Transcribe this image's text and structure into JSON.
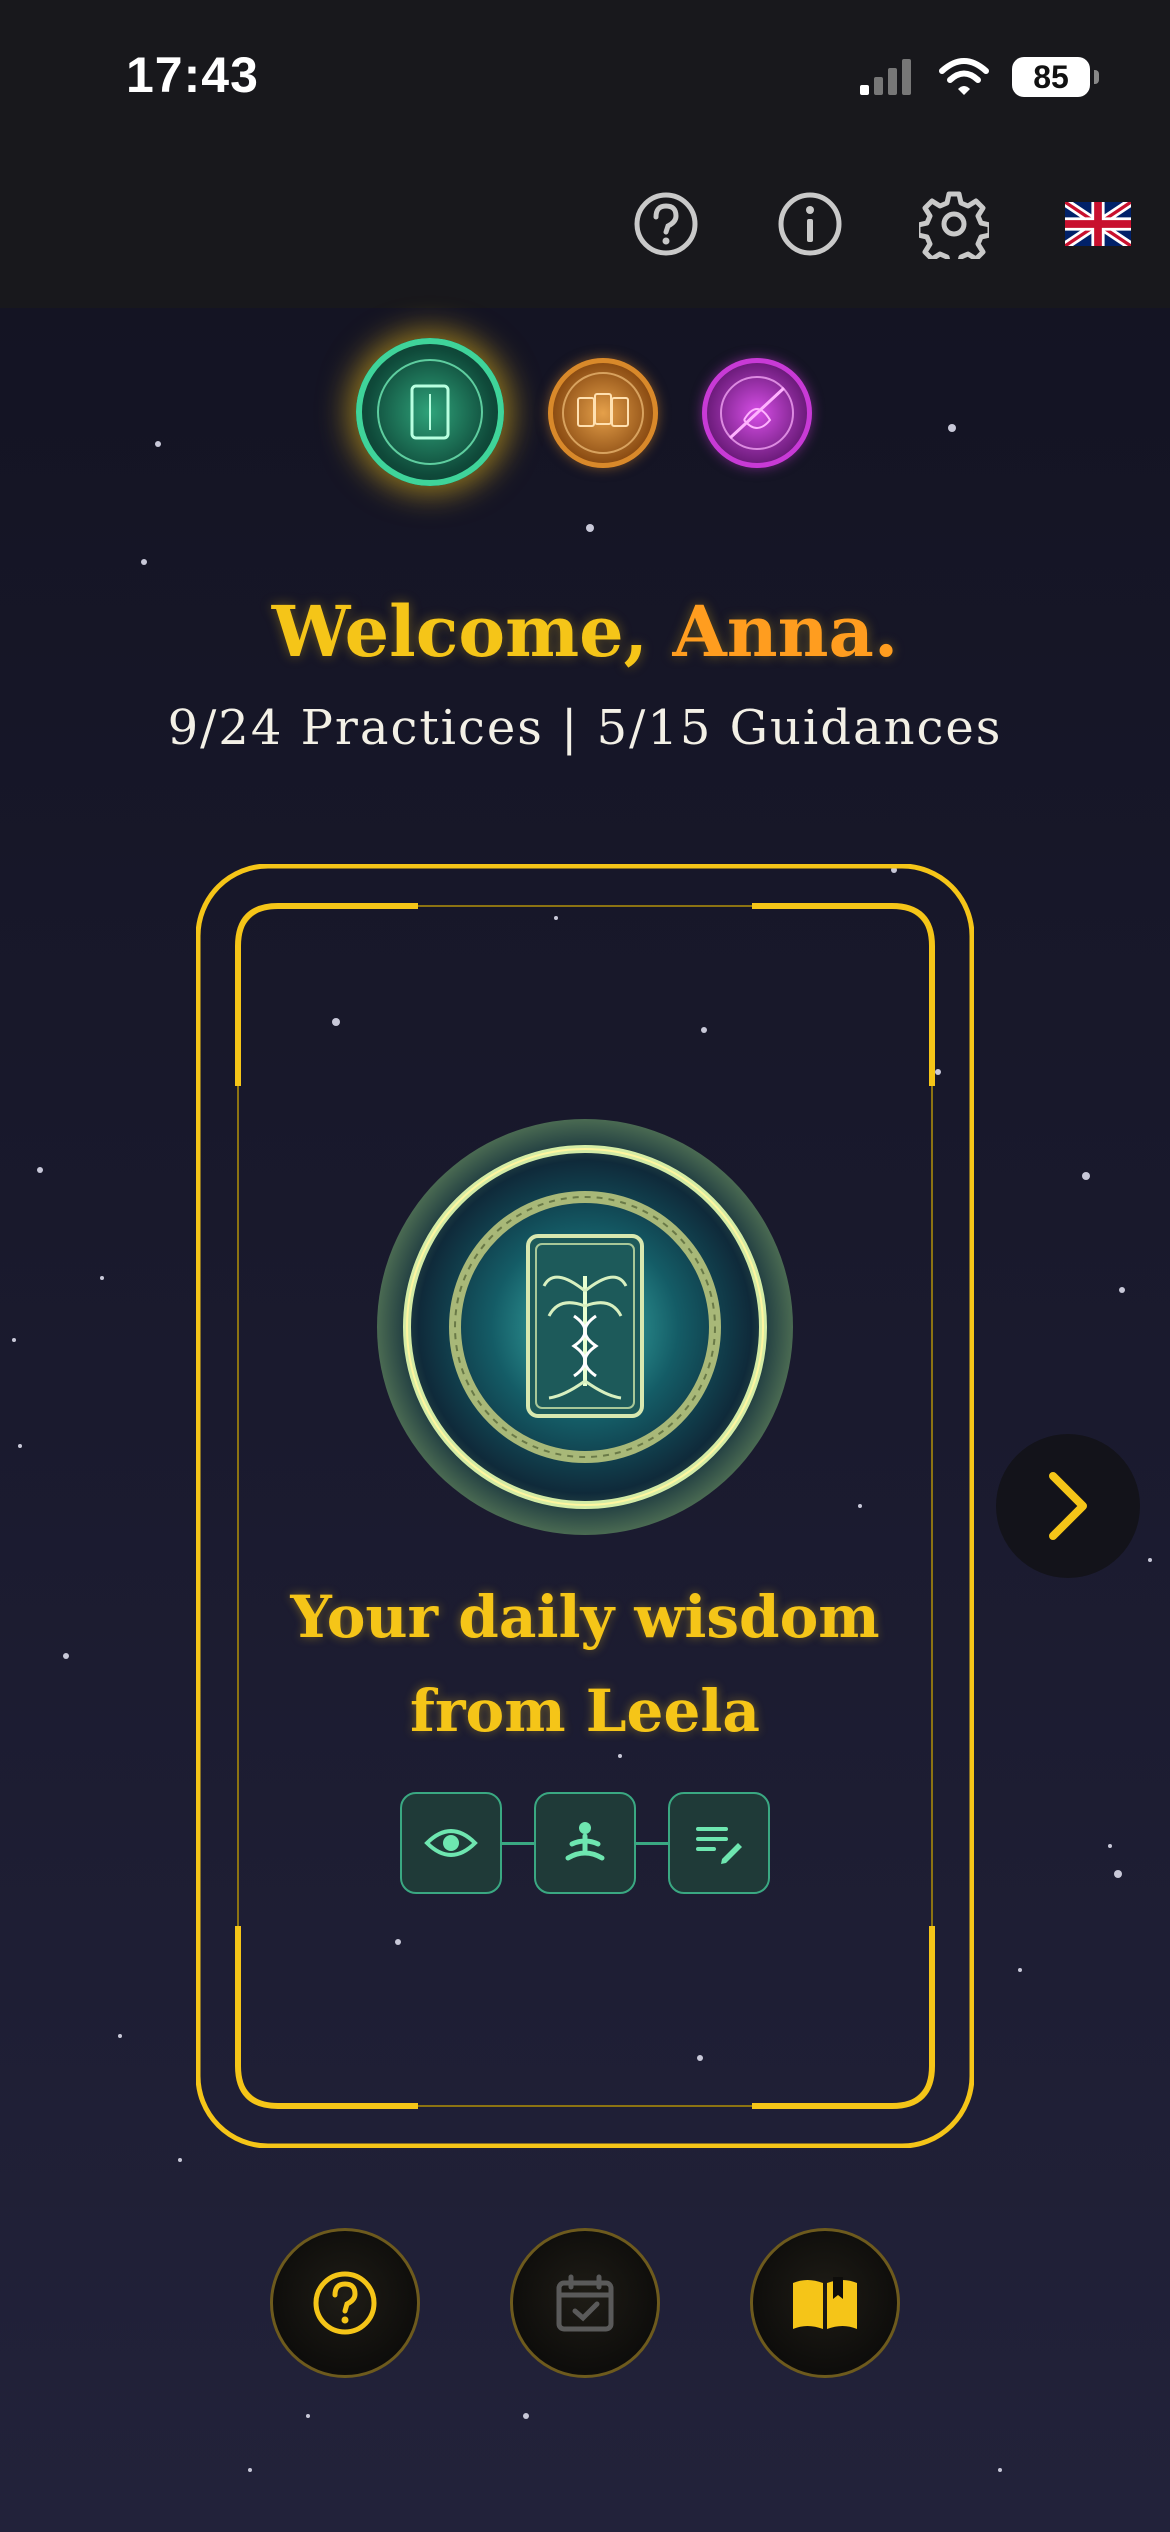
{
  "status_bar": {
    "time": "17:43",
    "battery": "85"
  },
  "header_icons": [
    {
      "name": "help-icon"
    },
    {
      "name": "info-icon"
    },
    {
      "name": "settings-icon"
    },
    {
      "name": "uk-flag-icon"
    }
  ],
  "greeting": {
    "prefix": "Welcome, ",
    "name": "Anna."
  },
  "progress_text": "9/24 Practices | 5/15 Guidances",
  "card": {
    "title_line1": "Your daily wisdom",
    "title_line2": "from Leela",
    "modes": [
      "eye-icon",
      "meditation-icon",
      "journal-icon"
    ]
  },
  "bottom_nav": [
    "help-icon",
    "calendar-check-icon",
    "book-icon"
  ],
  "colors": {
    "accent": "#f5c518",
    "name": "#ff9d1f",
    "mode_green": "#3aa882",
    "medal_green": "#2fa37a",
    "medal_orange": "#d9892a",
    "medal_purple": "#c83ad6"
  }
}
